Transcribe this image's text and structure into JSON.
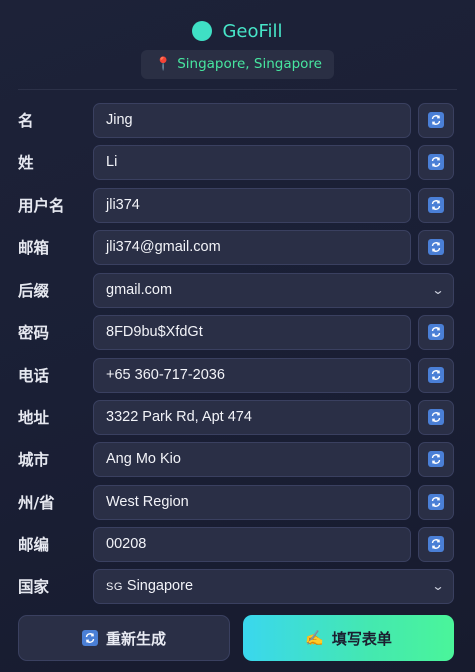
{
  "header": {
    "title": "GeoFill",
    "location": "Singapore, Singapore"
  },
  "fields": [
    {
      "label": "名",
      "value": "Jing",
      "type": "text"
    },
    {
      "label": "姓",
      "value": "Li",
      "type": "text"
    },
    {
      "label": "用户名",
      "value": "jli374",
      "type": "text"
    },
    {
      "label": "邮箱",
      "value": "jli374@gmail.com",
      "type": "text"
    },
    {
      "label": "后缀",
      "value": "gmail.com",
      "type": "select"
    },
    {
      "label": "密码",
      "value": "8FD9bu$XfdGt",
      "type": "text"
    },
    {
      "label": "电话",
      "value": "+65 360-717-2036",
      "type": "text"
    },
    {
      "label": "地址",
      "value": "3322 Park Rd, Apt 474",
      "type": "text"
    },
    {
      "label": "城市",
      "value": "Ang Mo Kio",
      "type": "text"
    },
    {
      "label": "州/省",
      "value": "West Region",
      "type": "text"
    },
    {
      "label": "邮编",
      "value": "00208",
      "type": "text"
    },
    {
      "label": "国家",
      "value": "Singapore",
      "flag": "SG",
      "type": "select"
    }
  ],
  "buttons": {
    "regenerate": "重新生成",
    "fill": "填写表单"
  },
  "colors": {
    "accent": "#47e6c8",
    "location_text": "#47e6a0",
    "refresh_icon": "#4a7fd6"
  }
}
